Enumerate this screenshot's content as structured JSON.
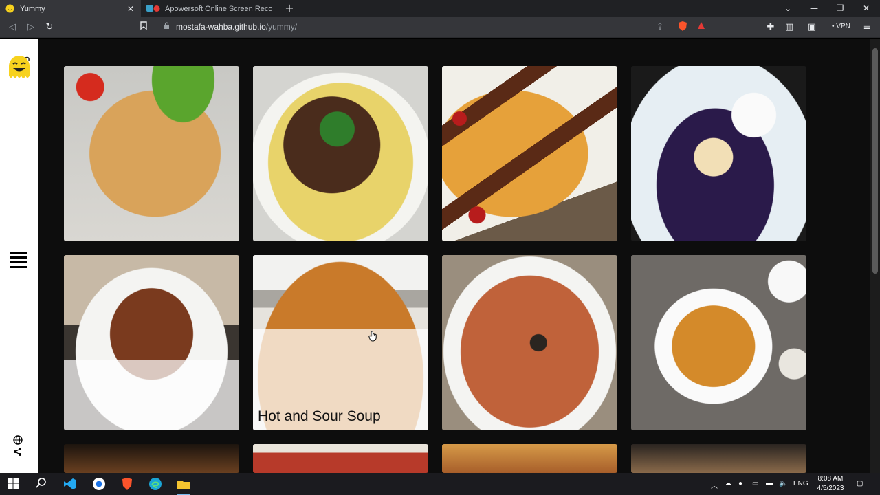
{
  "browser": {
    "tabs": [
      {
        "title": "Yummy",
        "active": true
      },
      {
        "title": "Apowersoft Online Screen Recorde",
        "active": false
      }
    ],
    "url_host": "mostafa-wahba.github.io",
    "url_path": "/yummy/",
    "vpn_label": "VPN"
  },
  "meals": [
    {
      "caption": "",
      "overlay": false
    },
    {
      "caption": "",
      "overlay": false
    },
    {
      "caption": "",
      "overlay": false
    },
    {
      "caption": "",
      "overlay": false
    },
    {
      "caption": "",
      "overlay": true
    },
    {
      "caption": "Hot and Sour Soup",
      "overlay": true
    },
    {
      "caption": "",
      "overlay": false
    },
    {
      "caption": "",
      "overlay": false
    }
  ],
  "taskbar": {
    "lang": "ENG",
    "time": "8:08 AM",
    "date": "4/5/2023"
  },
  "colors": {
    "accent": "#f7d21e",
    "page_bg": "#0d0d0d"
  }
}
